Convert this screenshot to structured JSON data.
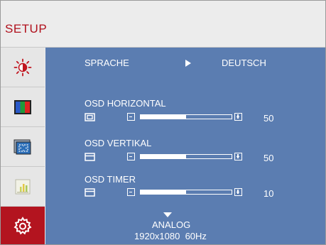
{
  "header": {
    "title": "SETUP"
  },
  "sidebar": {
    "items": [
      {
        "icon": "brightness-icon"
      },
      {
        "icon": "color-icon"
      },
      {
        "icon": "image-position-icon"
      },
      {
        "icon": "picture-icon"
      },
      {
        "icon": "settings-gear-icon",
        "active": true
      }
    ]
  },
  "main": {
    "language": {
      "label": "SPRACHE",
      "value": "DEUTSCH"
    },
    "osd_horizontal": {
      "label": "OSD HORIZONTAL",
      "value": "50",
      "level": 0.5
    },
    "osd_vertical": {
      "label": "OSD VERTIKAL",
      "value": "50",
      "level": 0.5
    },
    "osd_timer": {
      "label": "OSD TIMER",
      "value": "10",
      "level": 0.5
    },
    "source": {
      "label": "ANALOG",
      "resolution": "1920x1080",
      "refresh": "60Hz"
    }
  },
  "colors": {
    "accent": "#b3141f",
    "panel": "#5b7db1",
    "header_text": "#b0101c"
  }
}
